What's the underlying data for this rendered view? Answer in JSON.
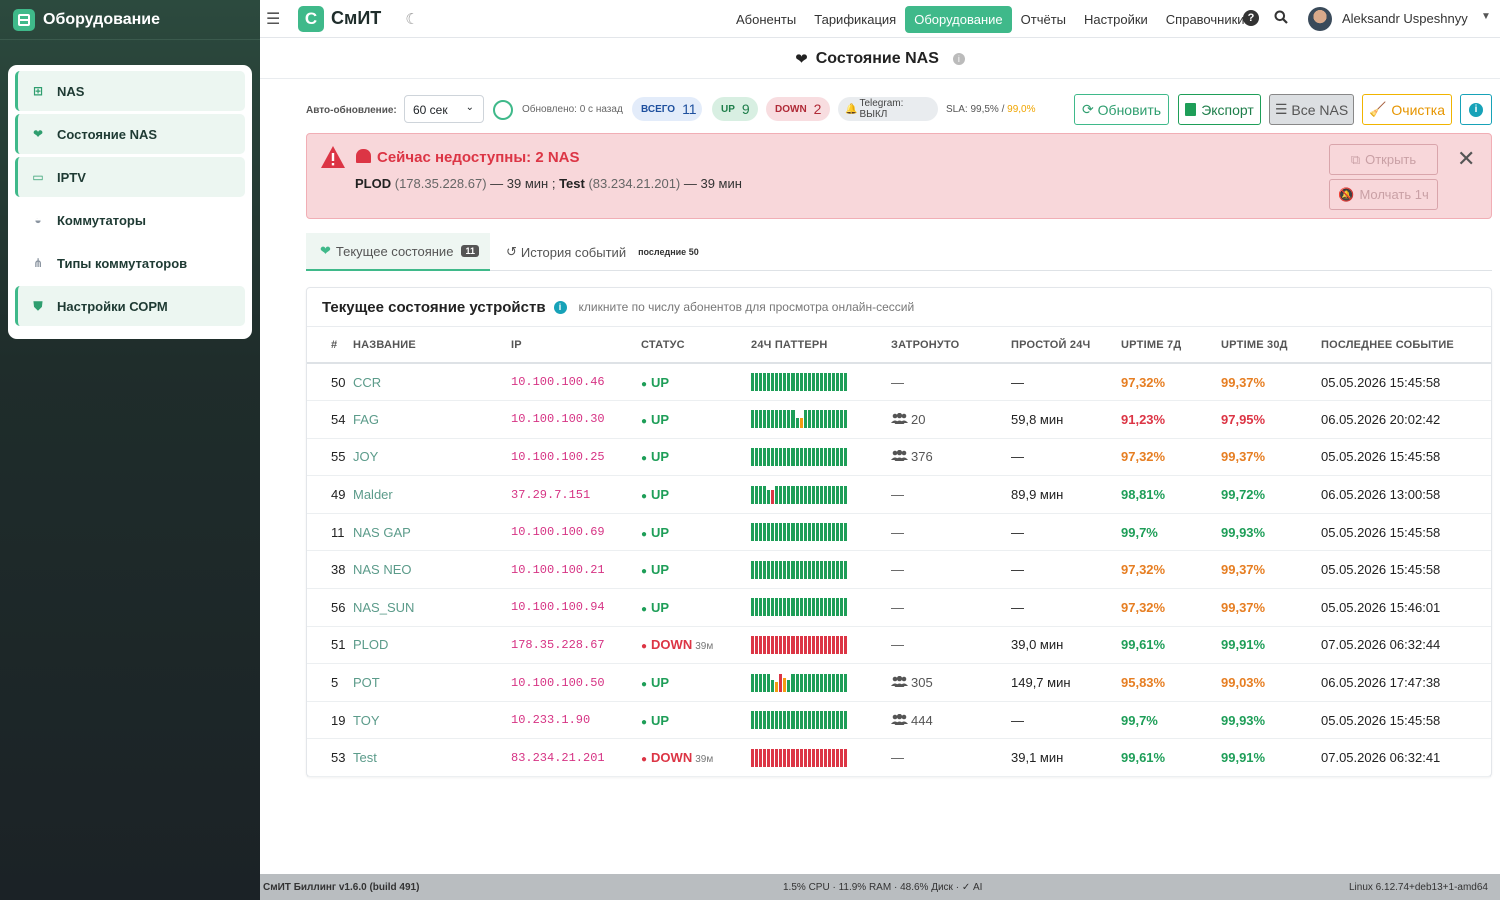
{
  "sidebar": {
    "brand": "Оборудование",
    "items": [
      {
        "label": "NAS",
        "icon": "network-icon",
        "active": true
      },
      {
        "label": "Состояние NAS",
        "icon": "heartbeat-icon",
        "active": true
      },
      {
        "label": "IPTV",
        "icon": "tv-icon",
        "active": true
      },
      {
        "label": "Коммутаторы",
        "icon": "switch-icon",
        "active": false
      },
      {
        "label": "Типы коммутаторов",
        "icon": "sitemap-icon",
        "active": false
      },
      {
        "label": "Настройки СОРМ",
        "icon": "shield-icon",
        "active": true
      }
    ]
  },
  "topbar": {
    "logo_letter": "С",
    "logo_text": "СмИТ",
    "nav": [
      "Абоненты",
      "Тарификация",
      "Оборудование",
      "Отчёты",
      "Настройки",
      "Справочники"
    ],
    "active_nav": "Оборудование",
    "help": "?",
    "user": "Aleksandr Uspeshnyy"
  },
  "page": {
    "title": "Состояние NAS",
    "info": "i"
  },
  "controls": {
    "auto_label": "Авто-обновление:",
    "interval": "60 сек",
    "updated": "Обновлено: 0 с назад",
    "total_label": "ВСЕГО",
    "total": "11",
    "up_label": "UP",
    "up": "9",
    "down_label": "DOWN",
    "down": "2",
    "telegram": "Telegram: ВЫКЛ",
    "sla_label": "SLA: 99,5%",
    "sla_sep": " / ",
    "sla_value": "99,0%",
    "btn_refresh": "Обновить",
    "btn_export": "Экспорт",
    "btn_all": "Все NAS",
    "btn_clear": "Очистка",
    "btn_info": "i"
  },
  "alert": {
    "title": "Сейчас недоступны: 2 NAS",
    "n1": "PLOD",
    "ip1": "(178.35.228.67)",
    "t1": " — 39 мин ; ",
    "n2": "Test",
    "ip2": "(83.234.21.201)",
    "t2": " — 39 мин",
    "btn_open": "Открыть",
    "btn_mute": "Молчать 1ч"
  },
  "tabs": {
    "current": "Текущее состояние",
    "current_count": "11",
    "history": "История событий",
    "history_note": "последние 50"
  },
  "card": {
    "title": "Текущее состояние устройств",
    "hint": "кликните по числу абонентов для просмотра онлайн-сессий"
  },
  "table": {
    "headers": [
      "#",
      "Название",
      "IP",
      "Статус",
      "24ч паттерн",
      "Затронуто",
      "Простой 24ч",
      "Uptime 7д",
      "Uptime 30д",
      "Последнее событие"
    ],
    "rows": [
      {
        "id": "50",
        "name": "CCR",
        "ip": "10.100.100.46",
        "status": "UP",
        "ago": "",
        "pattern": "g",
        "affected": "—",
        "users": false,
        "downtime": "—",
        "u7": "97,32%",
        "u7c": "o1",
        "u30": "99,37%",
        "u30c": "o1",
        "last": "05.05.2026 15:45:58"
      },
      {
        "id": "54",
        "name": "FAG",
        "ip": "10.100.100.30",
        "status": "UP",
        "ago": "",
        "pattern": "fag",
        "affected": "20",
        "users": true,
        "downtime": "59,8 мин",
        "u7": "91,23%",
        "u7c": "r1",
        "u30": "97,95%",
        "u30c": "r1",
        "last": "06.05.2026 20:02:42"
      },
      {
        "id": "55",
        "name": "JOY",
        "ip": "10.100.100.25",
        "status": "UP",
        "ago": "",
        "pattern": "g",
        "affected": "376",
        "users": true,
        "downtime": "—",
        "u7": "97,32%",
        "u7c": "o1",
        "u30": "99,37%",
        "u30c": "o1",
        "last": "05.05.2026 15:45:58"
      },
      {
        "id": "49",
        "name": "Malder",
        "ip": "37.29.7.151",
        "status": "UP",
        "ago": "",
        "pattern": "malder",
        "affected": "—",
        "users": false,
        "downtime": "89,9 мин",
        "u7": "98,81%",
        "u7c": "g1",
        "u30": "99,72%",
        "u30c": "g1",
        "last": "06.05.2026 13:00:58"
      },
      {
        "id": "11",
        "name": "NAS GAP",
        "ip": "10.100.100.69",
        "status": "UP",
        "ago": "",
        "pattern": "g",
        "affected": "—",
        "users": false,
        "downtime": "—",
        "u7": "99,7%",
        "u7c": "g1",
        "u30": "99,93%",
        "u30c": "g1",
        "last": "05.05.2026 15:45:58"
      },
      {
        "id": "38",
        "name": "NAS NEO",
        "ip": "10.100.100.21",
        "status": "UP",
        "ago": "",
        "pattern": "g",
        "affected": "—",
        "users": false,
        "downtime": "—",
        "u7": "97,32%",
        "u7c": "o1",
        "u30": "99,37%",
        "u30c": "o1",
        "last": "05.05.2026 15:45:58"
      },
      {
        "id": "56",
        "name": "NAS_SUN",
        "ip": "10.100.100.94",
        "status": "UP",
        "ago": "",
        "pattern": "g",
        "affected": "—",
        "users": false,
        "downtime": "—",
        "u7": "97,32%",
        "u7c": "o1",
        "u30": "99,37%",
        "u30c": "o1",
        "last": "05.05.2026 15:46:01"
      },
      {
        "id": "51",
        "name": "PLOD",
        "ip": "178.35.228.67",
        "status": "DOWN",
        "ago": "39м",
        "pattern": "r",
        "affected": "—",
        "users": false,
        "downtime": "39,0 мин",
        "u7": "99,61%",
        "u7c": "g1",
        "u30": "99,91%",
        "u30c": "g1",
        "last": "07.05.2026 06:32:44"
      },
      {
        "id": "5",
        "name": "POT",
        "ip": "10.100.100.50",
        "status": "UP",
        "ago": "",
        "pattern": "pot",
        "affected": "305",
        "users": true,
        "downtime": "149,7 мин",
        "u7": "95,83%",
        "u7c": "o1",
        "u30": "99,03%",
        "u30c": "o1",
        "last": "06.05.2026 17:47:38"
      },
      {
        "id": "19",
        "name": "TOY",
        "ip": "10.233.1.90",
        "status": "UP",
        "ago": "",
        "pattern": "g",
        "affected": "444",
        "users": true,
        "downtime": "—",
        "u7": "99,7%",
        "u7c": "g1",
        "u30": "99,93%",
        "u30c": "g1",
        "last": "05.05.2026 15:45:58"
      },
      {
        "id": "53",
        "name": "Test",
        "ip": "83.234.21.201",
        "status": "DOWN",
        "ago": "39м",
        "pattern": "r",
        "affected": "—",
        "users": false,
        "downtime": "39,1 мин",
        "u7": "99,61%",
        "u7c": "g1",
        "u30": "99,91%",
        "u30c": "g1",
        "last": "07.05.2026 06:32:41"
      }
    ]
  },
  "footer": {
    "left": "СмИТ Биллинг v1.6.0 (build 491)",
    "center": "1.5% CPU · 11.9% RAM · 48.6% Диск · ✓ AI",
    "right": "Linux 6.12.74+deb13+1-amd64"
  },
  "colors": {
    "accent": "#3fb98a",
    "up": "#1e9e58",
    "down": "#dc3545",
    "warn": "#e67e22"
  }
}
